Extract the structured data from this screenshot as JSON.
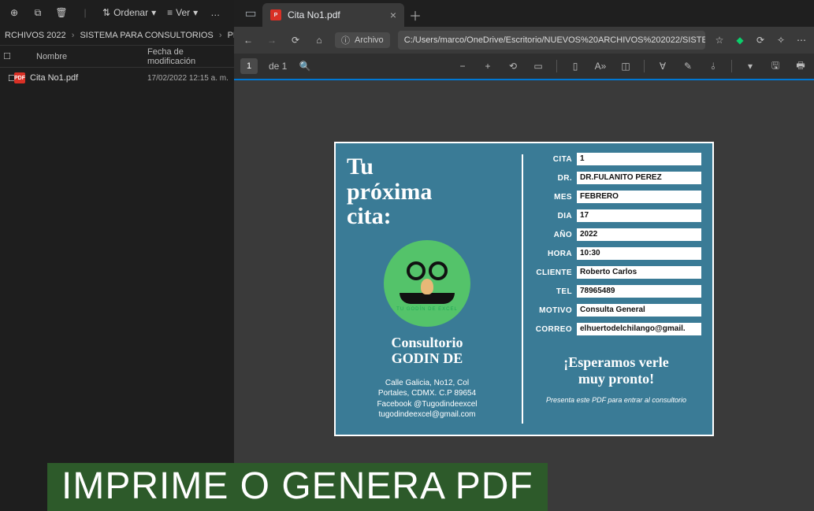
{
  "explorer": {
    "toolbar": {
      "sort": "Ordenar",
      "view": "Ver",
      "more": "…"
    },
    "breadcrumb": [
      "RCHIVOS 2022",
      "SISTEMA PARA CONSULTORIOS",
      "PDFCitas"
    ],
    "columns": {
      "name": "Nombre",
      "modified": "Fecha de modificación"
    },
    "files": [
      {
        "name": "Cita No1.pdf",
        "modified": "17/02/2022 12:15 a. m."
      }
    ]
  },
  "browser": {
    "tab_title": "Cita No1.pdf",
    "address_label": "Archivo",
    "url": "C:/Users/marco/OneDrive/Escritorio/NUEVOS%20ARCHIVOS%202022/SISTE…",
    "pdf_tools": {
      "page": "1",
      "of": "de 1"
    }
  },
  "pdf": {
    "headline": "Tu próxima cita:",
    "logo_text": "TU GODÍN DE EXCEL",
    "consultorio": "Consultorio GODIN DE",
    "address": [
      "Calle Galicia, No12, Col",
      "Portales, CDMX. C.P 89654",
      "Facebook @Tugodindeexcel",
      "tugodindeexcel@gmail.com"
    ],
    "fields": [
      {
        "label": "CITA",
        "value": "1"
      },
      {
        "label": "DR.",
        "value": "DR.FULANITO PEREZ"
      },
      {
        "label": "MES",
        "value": "FEBRERO"
      },
      {
        "label": "DIA",
        "value": "17"
      },
      {
        "label": "AÑO",
        "value": "2022"
      },
      {
        "label": "HORA",
        "value": "10:30"
      },
      {
        "label": "CLIENTE",
        "value": "Roberto Carlos"
      },
      {
        "label": "TEL",
        "value": "78965489"
      },
      {
        "label": "MOTIVO",
        "value": "Consulta General"
      },
      {
        "label": "CORREO",
        "value": "elhuertodelchilango@gmail."
      }
    ],
    "closing": "¡Esperamos verle muy pronto!",
    "presenta": "Presenta este PDF para entrar al consultorio"
  },
  "caption": "IMPRIME O GENERA PDF"
}
